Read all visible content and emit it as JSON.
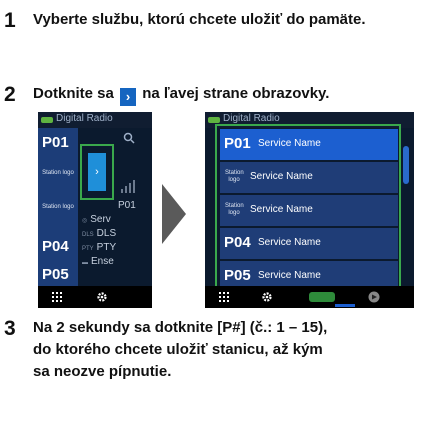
{
  "steps": [
    {
      "num": "1",
      "text": "Vyberte službu, ktorú chcete uložiť do pamäte."
    },
    {
      "num": "2",
      "text_before": "Dotknite sa",
      "text_after": "na ľavej strane obrazovky.",
      "button_glyph": "›"
    },
    {
      "num": "3",
      "line1": "Na 2 sekundy sa dotknite [P#] (č.: 1 – 15),",
      "line2": "do ktorého chcete uložiť stanicu, až kým",
      "line3": "sa neozve pípnutie."
    }
  ],
  "left_screen": {
    "title": "Digital Radio",
    "presets": [
      "P01",
      "P04",
      "P05"
    ],
    "station_logo": "Station logo",
    "arrow_glyph": "›",
    "right_info": {
      "p01": "P01",
      "service": "Serv",
      "dls_tag": "DLS",
      "dls": "DLS",
      "pty_tag": "PTY",
      "pty": "PTY",
      "ens_tag": "",
      "ens": "Ense"
    }
  },
  "right_screen": {
    "title": "Digital Radio",
    "rows": [
      {
        "preset": "P01",
        "name": "Service Name"
      },
      {
        "logo": "Station logo",
        "name": "Service Name"
      },
      {
        "logo": "Station logo",
        "name": "Service Name"
      },
      {
        "preset": "P04",
        "name": "Service Name"
      },
      {
        "preset": "P05",
        "name": "Service Name"
      }
    ]
  },
  "colors": {
    "accent": "#1c5fd0",
    "highlight": "#3aa84c",
    "row": "#1f3d77",
    "arrow": "#5a5a5a"
  }
}
